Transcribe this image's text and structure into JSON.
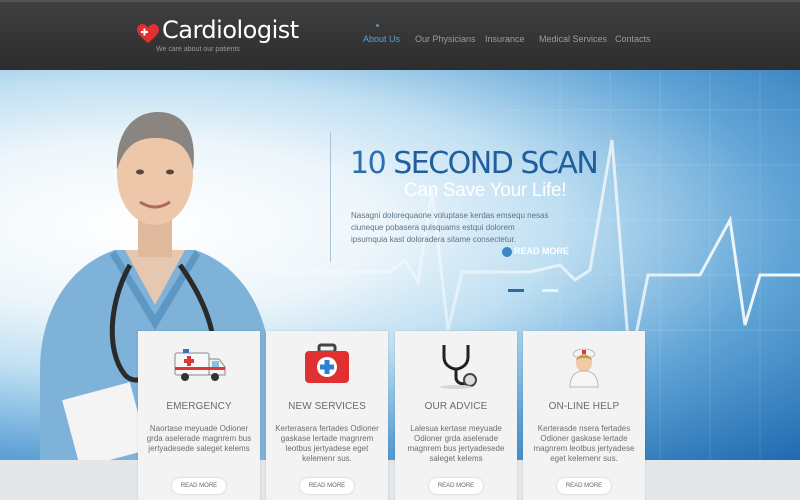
{
  "header": {
    "logo_text": "Cardiologist",
    "tagline": "We care about our patients",
    "nav": [
      {
        "label": "About Us",
        "active": true
      },
      {
        "label": "Our Physicians",
        "active": false
      },
      {
        "label": "Insurance",
        "active": false
      },
      {
        "label": "Medical Services",
        "active": false
      },
      {
        "label": "Contacts",
        "active": false
      }
    ]
  },
  "hero": {
    "title_number": "10",
    "title_rest": "SECOND SCAN",
    "subtitle": "Can Save Your Life!",
    "text": "Nasagni dolorequaone voluptase kerdas emsequ nesas ciuneque pobasera quisquams estqui dolorem ipsumquia kast doloradera sitame consectetur.",
    "read_more": "READ MORE",
    "pager_active": 1,
    "pager_count": 2
  },
  "cards": [
    {
      "icon": "ambulance-icon",
      "title": "EMERGENCY",
      "text": "Naortase meyuade Odioner grda aselerade magnrem bus jertyadesede saleget kelems",
      "button": "READ MORE"
    },
    {
      "icon": "first-aid-kit-icon",
      "title": "NEW SERVICES",
      "text": "Kerterasera fertades Odioner gaskase lertade magnrem leotbus jertyadese eget kelemenr sus.",
      "button": "READ MORE"
    },
    {
      "icon": "stethoscope-icon",
      "title": "OUR ADVICE",
      "text": "Lalesua kertase meyuade Odioner grda aselerade magnrem bus jertyadesede saleget kelems",
      "button": "READ MORE"
    },
    {
      "icon": "nurse-icon",
      "title": "ON-LINE HELP",
      "text": "Kerterasde nsera fertades Odioner gaskase lertade magnrem leotbus jertyadese eget kelemenr sus.",
      "button": "READ MORE"
    }
  ],
  "colors": {
    "header_bg": "#333333",
    "nav_active": "#4fa3dd",
    "hero_title": "#2b6fb0",
    "heart": "#e0302f"
  }
}
